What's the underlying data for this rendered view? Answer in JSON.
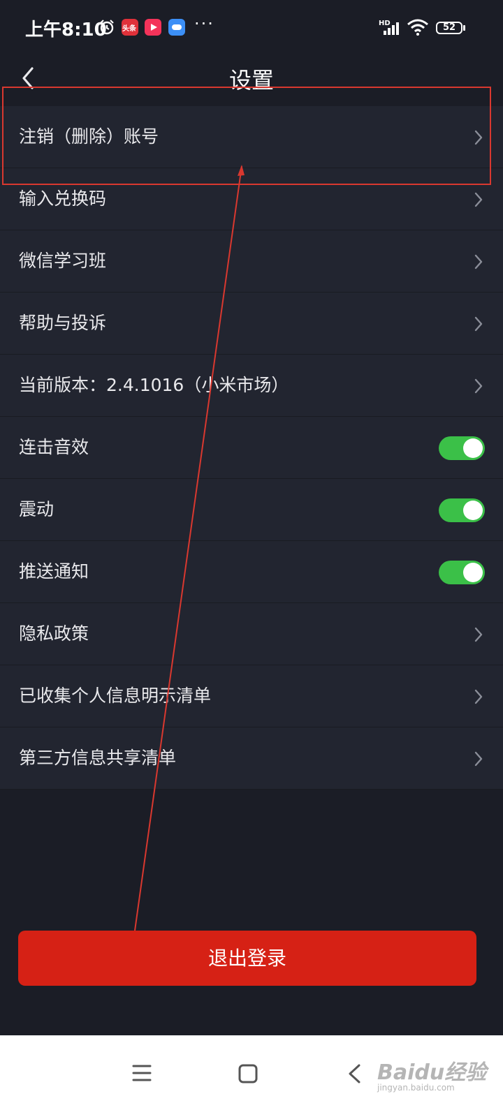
{
  "status_bar": {
    "time": "上午8:10",
    "hd_label": "HD",
    "battery": "52",
    "more": "···",
    "toutiao_badge": "头条"
  },
  "header": {
    "title": "设置"
  },
  "settings": {
    "items": [
      {
        "label": "注销（删除）账号",
        "control": "chevron"
      },
      {
        "label": "输入兑换码",
        "control": "chevron"
      },
      {
        "label": "微信学习班",
        "control": "chevron"
      },
      {
        "label": "帮助与投诉",
        "control": "chevron"
      },
      {
        "label": "当前版本：2.4.1016（小米市场）",
        "control": "chevron"
      },
      {
        "label": "连击音效",
        "control": "toggle",
        "on": true
      },
      {
        "label": "震动",
        "control": "toggle",
        "on": true
      },
      {
        "label": "推送通知",
        "control": "toggle",
        "on": true
      },
      {
        "label": "隐私政策",
        "control": "chevron"
      },
      {
        "label": "已收集个人信息明示清单",
        "control": "chevron"
      },
      {
        "label": "第三方信息共享清单",
        "control": "chevron"
      }
    ]
  },
  "logout": {
    "label": "退出登录"
  },
  "watermark": {
    "text": "Baidu经验",
    "url": "jingyan.baidu.com"
  },
  "colors": {
    "background": "#1b1d26",
    "row_background": "#222530",
    "toggle_on": "#3bc048",
    "logout_button": "#d62115",
    "annotation": "#d9382f"
  }
}
